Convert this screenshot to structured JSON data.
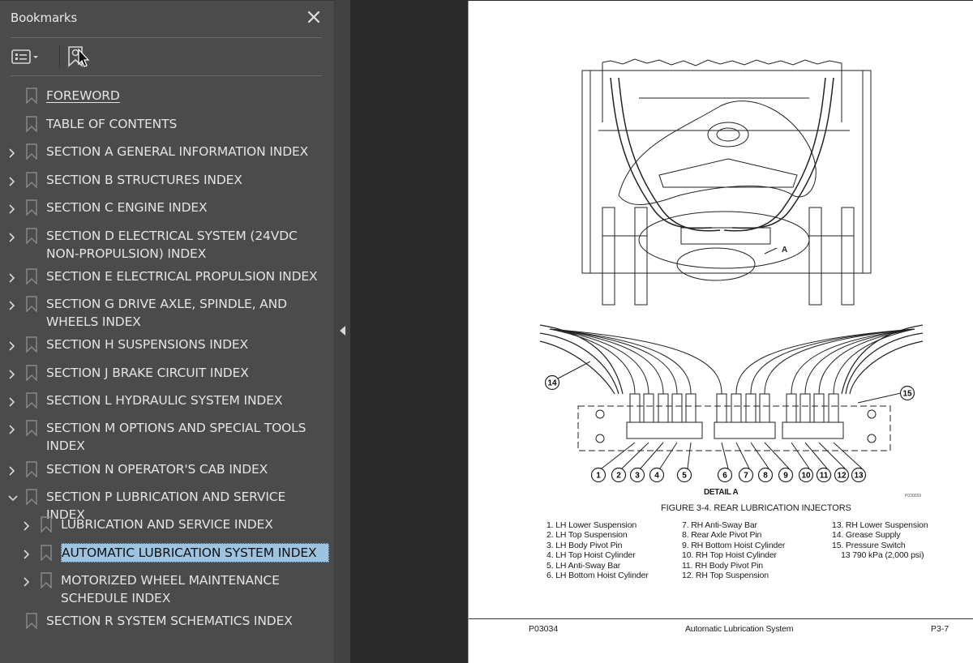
{
  "sidebar": {
    "title": "Bookmarks",
    "close_icon": "close-icon",
    "toolbar": {
      "options_icon": "list-options-icon",
      "dropdown_icon": "caret-down-icon",
      "find_bookmark_icon": "find-current-bookmark-icon"
    },
    "items": [
      {
        "label": "FOREWORD",
        "level": 0,
        "expandable": false,
        "underlined": true
      },
      {
        "label": "TABLE OF CONTENTS",
        "level": 0,
        "expandable": false
      },
      {
        "label": "SECTION A GENERAL INFORMATION INDEX",
        "level": 0,
        "expandable": true,
        "expanded": false
      },
      {
        "label": "SECTION B STRUCTURES INDEX",
        "level": 0,
        "expandable": true,
        "expanded": false
      },
      {
        "label": "SECTION C ENGINE INDEX",
        "level": 0,
        "expandable": true,
        "expanded": false
      },
      {
        "label": "SECTION D ELECTRICAL SYSTEM (24VDC NON-PROPULSION) INDEX",
        "level": 0,
        "expandable": true,
        "expanded": false
      },
      {
        "label": "SECTION E ELECTRICAL PROPULSION INDEX",
        "level": 0,
        "expandable": true,
        "expanded": false
      },
      {
        "label": "SECTION G DRIVE AXLE, SPINDLE, AND WHEELS INDEX",
        "level": 0,
        "expandable": true,
        "expanded": false
      },
      {
        "label": "SECTION H SUSPENSIONS INDEX",
        "level": 0,
        "expandable": true,
        "expanded": false
      },
      {
        "label": "SECTION J BRAKE CIRCUIT INDEX",
        "level": 0,
        "expandable": true,
        "expanded": false
      },
      {
        "label": "SECTION L HYDRAULIC SYSTEM INDEX",
        "level": 0,
        "expandable": true,
        "expanded": false
      },
      {
        "label": "SECTION M OPTIONS AND SPECIAL TOOLS INDEX",
        "level": 0,
        "expandable": true,
        "expanded": false
      },
      {
        "label": "SECTION N OPERATOR'S CAB INDEX",
        "level": 0,
        "expandable": true,
        "expanded": false
      },
      {
        "label": "SECTION P LUBRICATION AND SERVICE INDEX",
        "level": 0,
        "expandable": true,
        "expanded": true
      },
      {
        "label": "LUBRICATION AND SERVICE INDEX",
        "level": 1,
        "expandable": true,
        "expanded": false
      },
      {
        "label": "AUTOMATIC LUBRICATION SYSTEM INDEX",
        "level": 1,
        "expandable": true,
        "expanded": false,
        "selected": true
      },
      {
        "label": "MOTORIZED WHEEL MAINTENANCE SCHEDULE INDEX",
        "level": 1,
        "expandable": true,
        "expanded": false
      },
      {
        "label": "SECTION R SYSTEM SCHEMATICS INDEX",
        "level": 0,
        "expandable": false
      }
    ]
  },
  "splitter": {
    "collapse_icon": "collapse-panel-arrow-icon"
  },
  "page": {
    "figure": {
      "detail_label": "DETAIL A",
      "detail_ref": "A",
      "figure_id": "P030059",
      "caption": "FIGURE 3-4. REAR LUBRICATION INJECTORS",
      "callouts": [
        "1",
        "2",
        "3",
        "4",
        "5",
        "6",
        "7",
        "8",
        "9",
        "10",
        "11",
        "12",
        "13",
        "14",
        "15"
      ],
      "legend": {
        "col1": [
          "1. LH Lower Suspension",
          "2. LH Top Suspension",
          "3. LH Body Pivot Pin",
          "4. LH Top Hoist Cylinder",
          "5. LH Anti-Sway Bar",
          "6. LH Bottom Hoist Cylinder"
        ],
        "col2": [
          "7. RH Anti-Sway Bar",
          "8. Rear Axle Pivot Pin",
          "9. RH Bottom Hoist Cylinder",
          "10. RH Top Hoist Cylinder",
          "11. RH Body Pivot Pin",
          "12. RH Top Suspension"
        ],
        "col3": [
          "13. RH Lower Suspension",
          "14. Grease Supply",
          "15. Pressure Switch",
          "    13 790 kPa (2,000 psi)"
        ]
      }
    },
    "footer": {
      "left": "P03034",
      "center": "Automatic Lubrication System",
      "right": "P3-7"
    }
  },
  "colors": {
    "sidebar_bg": "#4b4b4b",
    "selection": "#9cc3e0",
    "doc_bg": "#2a2a2a"
  }
}
